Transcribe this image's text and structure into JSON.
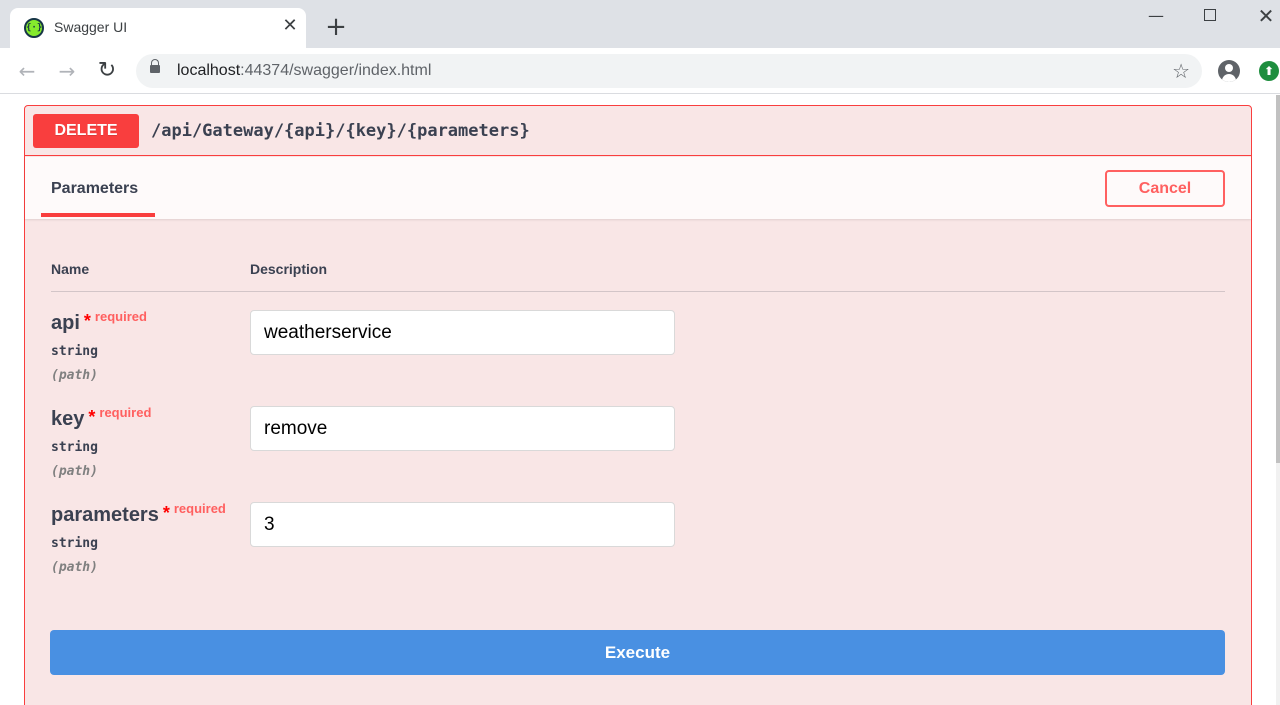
{
  "browser": {
    "tab_title": "Swagger UI",
    "tab_close": "✕",
    "new_tab": "+",
    "url_host": "localhost",
    "url_rest": ":44374/swagger/index.html",
    "icons": [
      "swagger-favicon-icon",
      "back-arrow-icon",
      "forward-arrow-icon",
      "reload-icon",
      "lock-icon",
      "bookmark-star-icon",
      "profile-icon",
      "extension-update-icon"
    ]
  },
  "operation": {
    "method": "DELETE",
    "path": "/api/Gateway/{api}/{key}/{parameters}",
    "method_color": "#f93e3e",
    "tab_label": "Parameters",
    "cancel_label": "Cancel",
    "execute_label": "Execute",
    "execute_color": "#4990e2"
  },
  "parameters": {
    "headers": {
      "name": "Name",
      "description": "Description"
    },
    "rows": [
      {
        "name": "api",
        "required_mark": "*",
        "required_label": "required",
        "type": "string",
        "in": "(path)",
        "value": "weatherservice"
      },
      {
        "name": "key",
        "required_mark": "*",
        "required_label": "required",
        "type": "string",
        "in": "(path)",
        "value": "remove"
      },
      {
        "name": "parameters",
        "required_mark": "*",
        "required_label": "required",
        "type": "string",
        "in": "(path)",
        "value": "3"
      }
    ]
  }
}
